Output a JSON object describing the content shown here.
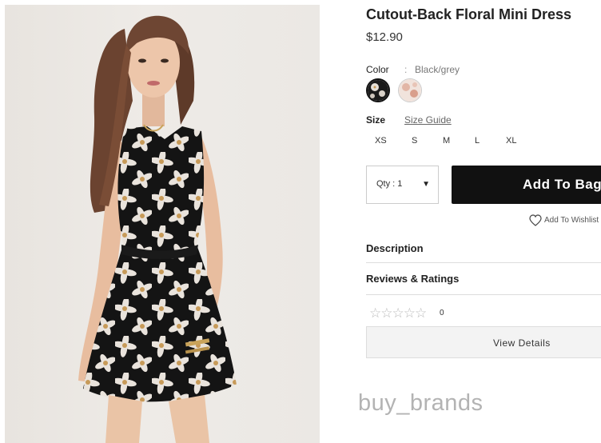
{
  "product": {
    "title": "Cutout-Back Floral Mini Dress",
    "price": "$12.90"
  },
  "color": {
    "label": "Color",
    "separator": ":",
    "selected_value": "Black/grey",
    "swatches": [
      {
        "name": "Black/grey",
        "selected": true
      },
      {
        "name": "Cream/pink",
        "selected": false
      }
    ]
  },
  "size": {
    "label": "Size",
    "guide_link": "Size Guide",
    "options": [
      "XS",
      "S",
      "M",
      "L",
      "XL"
    ]
  },
  "purchase": {
    "qty_label": "Qty : 1",
    "add_to_bag": "Add To Bag",
    "wishlist": "Add To Wishlist"
  },
  "sections": {
    "description": "Description",
    "reviews": "Reviews & Ratings"
  },
  "rating": {
    "stars_filled": 0,
    "stars_total": 5,
    "stars_text": "☆☆☆☆☆",
    "count": "0"
  },
  "view_details": "View Details",
  "watermark": "buy_brands",
  "colors": {
    "button_bg": "#111111",
    "divider": "#dddddd",
    "watermark": "#b3b3b3"
  }
}
